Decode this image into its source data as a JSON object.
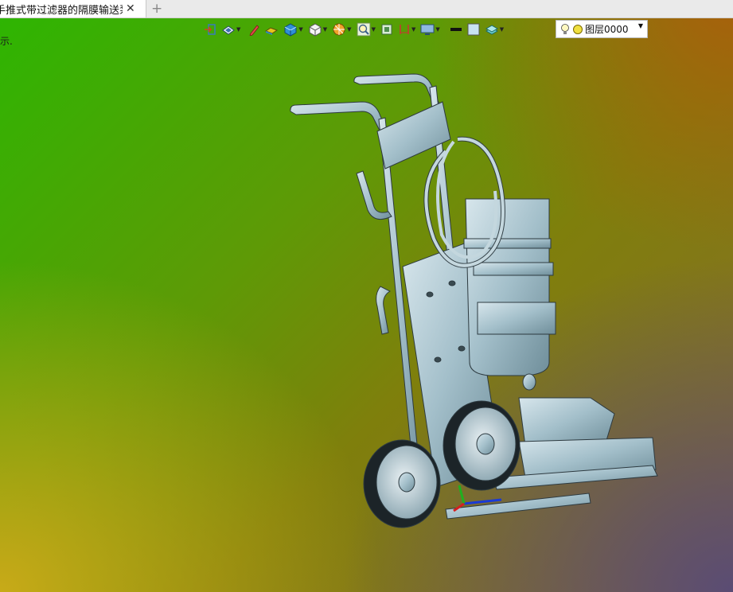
{
  "tab": {
    "title": "手推式带过滤器的隔膜输送泵]",
    "close_glyph": "✕",
    "add_glyph": "+"
  },
  "viewport": {
    "hint_text": "示."
  },
  "toolbar": {
    "icons": [
      "exit-icon",
      "view-orient-icon",
      "sketch-pen-icon",
      "face-style-icon",
      "solid-cube-icon",
      "wire-cube-icon",
      "render-sphere-icon",
      "zoom-lens-icon",
      "fit-view-icon",
      "dimension-icon",
      "display-monitor-icon",
      "line-color-swatch",
      "fill-color-swatch",
      "layer-stack-icon"
    ],
    "layer_label": "图层0000",
    "colors": {
      "line_color": "#111111",
      "fill_color": "#c8e2f2"
    }
  },
  "model": {
    "name": "手推式带过滤器的隔膜输送泵",
    "part_color": "#a9c4cf",
    "edge_color": "#2d3a40"
  }
}
